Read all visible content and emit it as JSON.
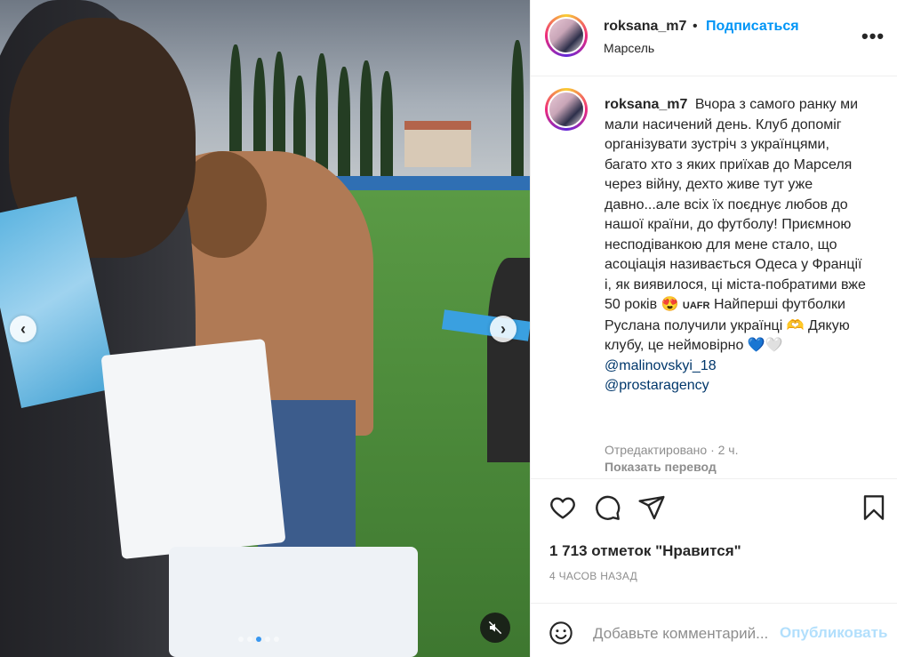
{
  "post": {
    "username": "roksana_m7",
    "follow_label": "Подписаться",
    "bullet": "•",
    "location": "Марсель",
    "more_label": "•••"
  },
  "caption": {
    "username": "roksana_m7",
    "text": "Вчора з самого ранку ми мали насичений день. Клуб допоміг організувати зустріч з українцями, багато хто з яких приїхав до Марселя через війну, дехто живе тут уже давно...але всіх їх поєднує любов до нашої країни, до футболу! Приємною несподіванкою для мене стало, що асоціація називається Одеса у Франції і, як виявилося, ці міста-побратими вже 50 років 😍",
    "badge": "UAFR",
    "text2": "Найперші футболки Руслана получили українці 🫶 Дякую клубу, це неймовірно",
    "hearts": "💙🤍",
    "mentions": [
      "@malinovskyi_18",
      "@prostaragency"
    ],
    "edited": "Отредактировано · 2 ч.",
    "translate_label": "Показать перевод"
  },
  "actions": {
    "icons": [
      "heart-icon",
      "comment-icon",
      "share-icon",
      "bookmark-icon"
    ]
  },
  "likes": "1 713 отметок \"Нравится\"",
  "time_ago": "4 ЧАСОВ НАЗАД",
  "comment": {
    "placeholder": "Добавьте комментарий...",
    "publish_label": "Опубликовать"
  },
  "carousel": {
    "prev_label": "‹",
    "next_label": "›",
    "slides": 5,
    "active_slide": 3
  },
  "colors": {
    "link_blue": "#0095f6",
    "mention_blue": "#00376b",
    "muted_gray": "#8e8e8e",
    "publish_disabled": "#b2dffc"
  }
}
